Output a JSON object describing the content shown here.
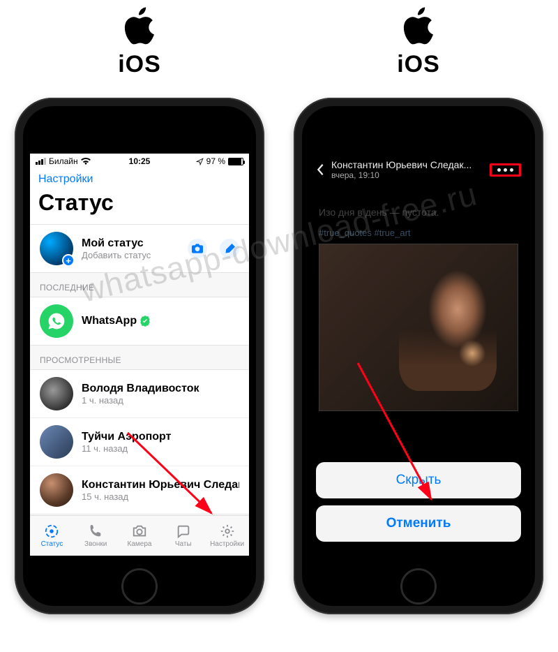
{
  "platform_label": "iOS",
  "watermark": "whatsapp-download-free.ru",
  "left": {
    "statusbar": {
      "carrier": "Билайн",
      "time": "10:25",
      "battery": "97 %"
    },
    "nav_back": "Настройки",
    "title": "Статус",
    "my_status": {
      "name": "Мой статус",
      "sub": "Добавить статус"
    },
    "section_recent": "ПОСЛЕДНИЕ",
    "recent": [
      {
        "name": "WhatsApp"
      }
    ],
    "section_viewed": "ПРОСМОТРЕННЫЕ",
    "viewed": [
      {
        "name": "Володя Владивосток",
        "sub": "1 ч. назад"
      },
      {
        "name": "Туйчи Аэропорт",
        "sub": "11 ч. назад"
      },
      {
        "name": "Константин Юрьевич Следак...",
        "sub": "15 ч. назад"
      }
    ],
    "tabs": [
      {
        "label": "Статус"
      },
      {
        "label": "Звонки"
      },
      {
        "label": "Камера"
      },
      {
        "label": "Чаты"
      },
      {
        "label": "Настройки"
      }
    ]
  },
  "right": {
    "header": {
      "name": "Константин Юрьевич Следак...",
      "time": "вчера, 19:10"
    },
    "caption": "Изо дня в день — пустота.",
    "tags": "#true_quotes #true_art",
    "sheet": {
      "hide": "Скрыть",
      "cancel": "Отменить"
    }
  }
}
